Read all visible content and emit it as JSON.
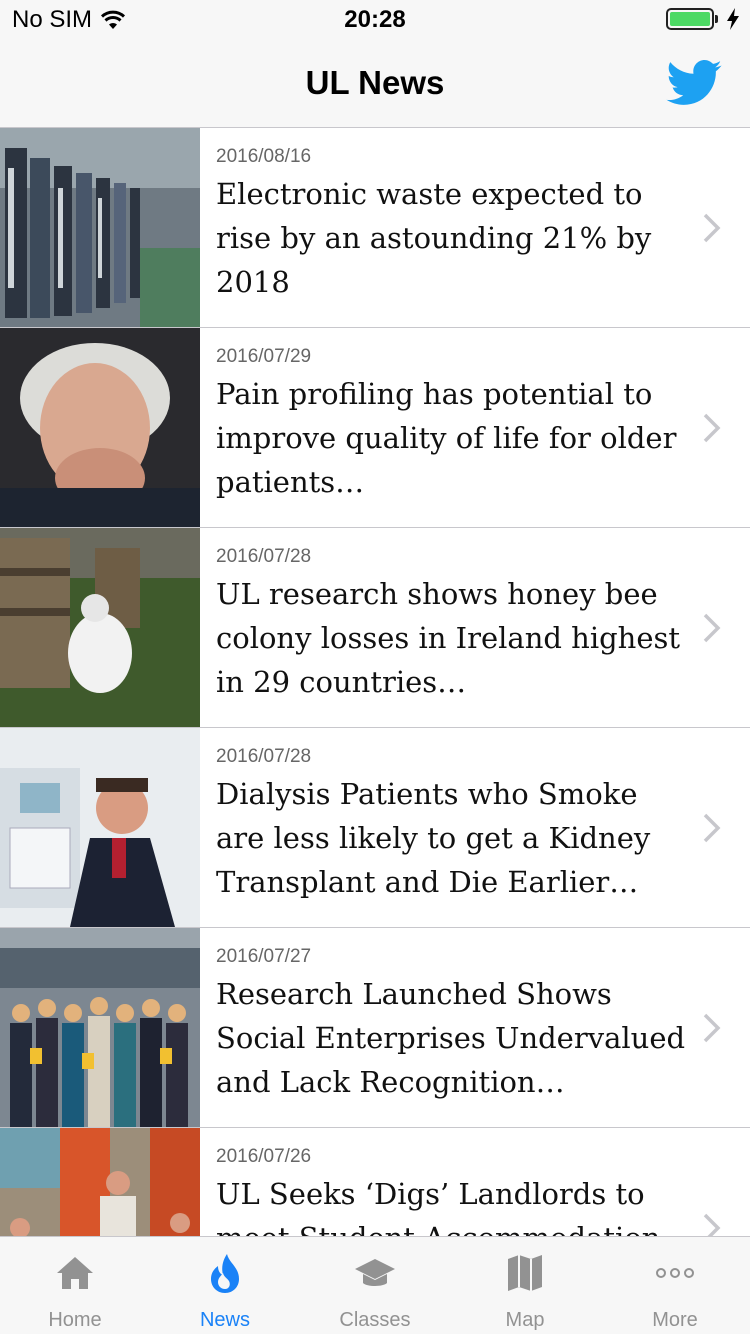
{
  "status_bar": {
    "carrier": "No SIM",
    "time": "20:28",
    "battery_level": 1.0,
    "battery_color": "#4cd964"
  },
  "nav": {
    "title": "UL News",
    "right_icon": "twitter-icon",
    "accent": "#1da1f2"
  },
  "news": [
    {
      "date": "2016/08/16",
      "title": "Electronic waste expected to rise by an astounding 21% by 2018"
    },
    {
      "date": "2016/07/29",
      "title": "Pain profiling has potential to improve quality of life for older patients…"
    },
    {
      "date": "2016/07/28",
      "title": "UL research shows honey bee colony losses in Ireland highest in 29 countries…"
    },
    {
      "date": "2016/07/28",
      "title": "Dialysis Patients who Smoke are less likely to get a Kidney Transplant and Die Earlier…"
    },
    {
      "date": "2016/07/27",
      "title": "Research Launched Shows Social Enterprises Undervalued and Lack Recognition…"
    },
    {
      "date": "2016/07/26",
      "title": "UL Seeks ‘Digs’ Landlords to meet Student Accommodation Demand"
    }
  ],
  "tabs": [
    {
      "label": "Home",
      "icon": "home-icon"
    },
    {
      "label": "News",
      "icon": "flame-icon"
    },
    {
      "label": "Classes",
      "icon": "graduation-cap-icon"
    },
    {
      "label": "Map",
      "icon": "map-icon"
    },
    {
      "label": "More",
      "icon": "more-dots-icon"
    }
  ],
  "active_tab": "News",
  "colors": {
    "tab_active": "#1a82f7",
    "tab_inactive": "#929292"
  }
}
